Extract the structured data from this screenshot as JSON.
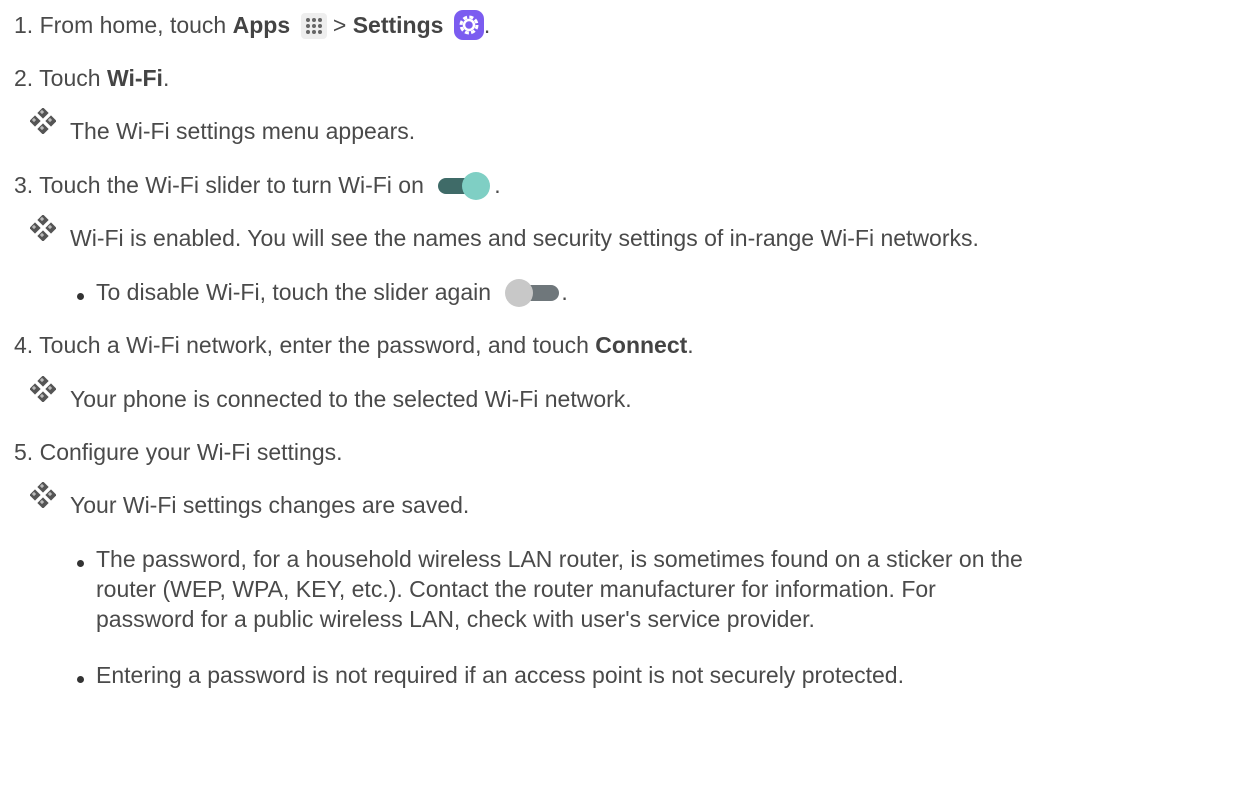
{
  "steps": [
    {
      "num": "1.",
      "pre": "From home, touch ",
      "apps": "Apps",
      "sep": " > ",
      "settings": "Settings",
      "post": "."
    },
    {
      "num": "2.",
      "pre": "Touch ",
      "bold": "Wi-Fi",
      "post": "."
    },
    {
      "num": "3.",
      "pre": "Touch the Wi-Fi slider to turn Wi-Fi on ",
      "post": "."
    },
    {
      "num": "4.",
      "pre": "Touch a Wi-Fi network, enter the password, and touch ",
      "bold": "Connect",
      "post": "."
    },
    {
      "num": "5.",
      "text": "Configure your Wi-Fi settings."
    }
  ],
  "results": [
    "The Wi-Fi settings menu appears.",
    "Wi-Fi is enabled. You will see the names and security settings of in-range Wi-Fi networks.",
    "Your phone is connected to the selected Wi-Fi network.",
    "Your Wi-Fi settings changes are saved."
  ],
  "bullets": [
    {
      "pre": "To disable Wi-Fi, touch the slider again ",
      "post": "."
    },
    {
      "lines": [
        "The password, for a household wireless LAN router, is sometimes found on a sticker on the",
        "router (WEP, WPA, KEY, etc.). Contact the router manufacturer for information. For",
        "password for a public wireless LAN, check with user's service provider."
      ]
    },
    {
      "text": "Entering a password is not required if an access point is not securely protected."
    }
  ],
  "icons": {
    "apps": "apps-grid-icon",
    "settings": "settings-gear-icon",
    "toggle_on": "toggle-on-icon",
    "toggle_off": "toggle-off-icon",
    "result_marker": "diamond-cluster-icon"
  },
  "colors": {
    "settings_icon": "#7b5cf0",
    "toggle_on_knob": "#7fcfc4",
    "toggle_on_track": "#3f6b68",
    "toggle_off_knob": "#c8c8c8",
    "toggle_off_track": "#6f777b"
  }
}
